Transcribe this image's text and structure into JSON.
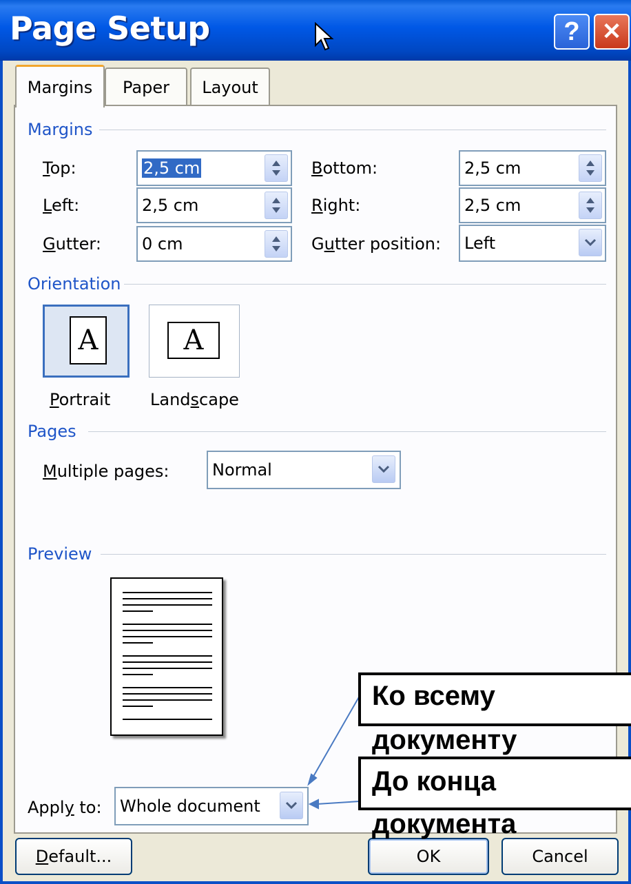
{
  "window": {
    "title": "Page Setup",
    "help_label": "?",
    "close_label": "✕"
  },
  "tabs": [
    {
      "label": "Margins",
      "active": true
    },
    {
      "label": "Paper",
      "active": false
    },
    {
      "label": "Layout",
      "active": false
    }
  ],
  "margins_group": {
    "title": "Margins",
    "top": {
      "label_u": "T",
      "label_rest": "op:",
      "value": "2,5 cm"
    },
    "left": {
      "label_u": "L",
      "label_rest": "eft:",
      "value": "2,5 cm"
    },
    "gutter": {
      "label_u": "G",
      "label_rest": "utter:",
      "value": "0 cm"
    },
    "bottom": {
      "label_u": "B",
      "label_rest": "ottom:",
      "value": "2,5 cm"
    },
    "right": {
      "label_u": "R",
      "label_rest": "ight:",
      "value": "2,5 cm"
    },
    "gutter_position": {
      "label_pre": "G",
      "label_u": "u",
      "label_rest": "tter position:",
      "value": "Left"
    }
  },
  "orientation_group": {
    "title": "Orientation",
    "portrait": {
      "label_u": "P",
      "label_rest": "ortrait",
      "glyph": "A",
      "selected": true
    },
    "landscape": {
      "label_pre": "Land",
      "label_u": "s",
      "label_rest": "cape",
      "glyph": "A",
      "selected": false
    }
  },
  "pages_group": {
    "title": "Pages",
    "multiple_pages": {
      "label_u": "M",
      "label_rest": "ultiple pages:",
      "value": "Normal"
    }
  },
  "preview_group": {
    "title": "Preview"
  },
  "apply_to": {
    "label_pre": "Appl",
    "label_u": "y",
    "label_rest": " to:",
    "value": "Whole document"
  },
  "buttons": {
    "default": {
      "label_u": "D",
      "label_rest": "efault..."
    },
    "ok": "OK",
    "cancel": "Cancel"
  },
  "callouts": [
    {
      "line1": "Ко всему",
      "line2": "документу"
    },
    {
      "line1": "До конца",
      "line2": "документа"
    }
  ],
  "icons": [
    "help-icon",
    "close-icon",
    "mouse-cursor-icon",
    "spin-arrows-icon",
    "dropdown-arrow-icon",
    "page-portrait-icon",
    "page-landscape-icon"
  ],
  "colors": {
    "titlebar": "#0058e6",
    "group_title": "#1f55c8",
    "selection": "#316ac5",
    "tab_accent": "#f2a62c",
    "callout_arrow": "#4a7ac2"
  }
}
